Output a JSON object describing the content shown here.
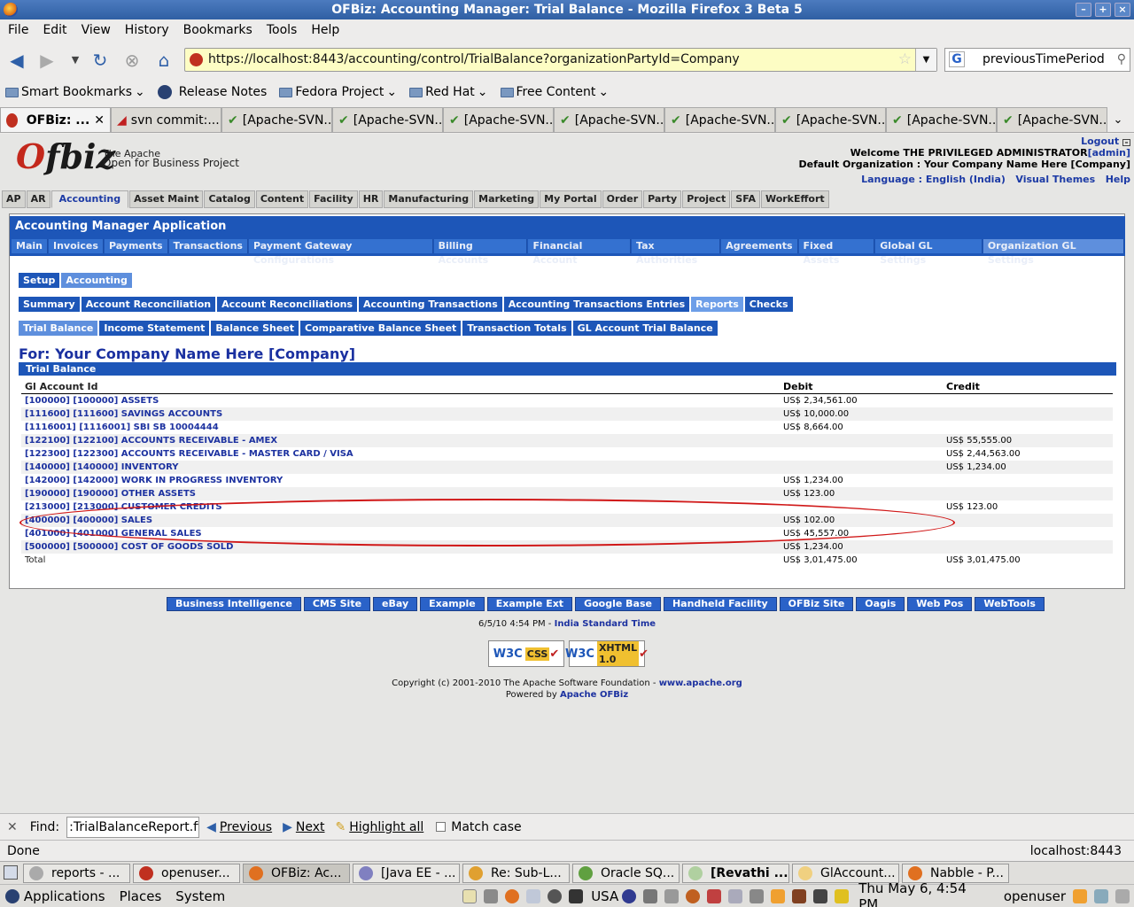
{
  "window": {
    "title": "OFBiz: Accounting Manager: Trial Balance - Mozilla Firefox 3 Beta 5"
  },
  "menu": [
    "File",
    "Edit",
    "View",
    "History",
    "Bookmarks",
    "Tools",
    "Help"
  ],
  "url": "https://localhost:8443/accounting/control/TrialBalance?organizationPartyId=Company",
  "search": {
    "value": "previousTimePeriod"
  },
  "bookmarks": [
    "Smart Bookmarks",
    "Release Notes",
    "Fedora Project",
    "Red Hat",
    "Free Content"
  ],
  "browser_tabs": [
    "OFBiz: ...",
    "svn commit:...",
    "[Apache-SVN...",
    "[Apache-SVN...",
    "[Apache-SVN...",
    "[Apache-SVN...",
    "[Apache-SVN...",
    "[Apache-SVN...",
    "[Apache-SVN...",
    "[Apache-SVN..."
  ],
  "header": {
    "logo_text": "fbiz",
    "logo_tag1": "The Apache",
    "logo_tag2": "Open for Business Project",
    "logout": "Logout",
    "welcome": "Welcome THE PRIVILEGED ADMINISTRATOR",
    "user": "[admin]",
    "org": "Default Organization : Your Company Name Here [Company]",
    "language": "Language : English (India)",
    "themes": "Visual Themes",
    "help": "Help"
  },
  "app_tabs": [
    "AP",
    "AR",
    "Accounting",
    "Asset Maint",
    "Catalog",
    "Content",
    "Facility",
    "HR",
    "Manufacturing",
    "Marketing",
    "My Portal",
    "Order",
    "Party",
    "Project",
    "SFA",
    "WorkEffort"
  ],
  "app_title": "Accounting Manager Application",
  "main_nav": [
    "Main",
    "Invoices",
    "Payments",
    "Transactions",
    "Payment Gateway Configurations",
    "Billing Accounts",
    "Financial Account",
    "Tax Authorities",
    "Agreements",
    "Fixed Assets",
    "Global GL Settings",
    "Organization GL Settings"
  ],
  "setup_nav": [
    "Setup",
    "Accounting"
  ],
  "acct_nav": [
    "Summary",
    "Account Reconciliation",
    "Account Reconciliations",
    "Accounting Transactions",
    "Accounting Transactions Entries",
    "Reports",
    "Checks"
  ],
  "report_nav": [
    "Trial Balance",
    "Income Statement",
    "Balance Sheet",
    "Comparative Balance Sheet",
    "Transaction Totals",
    "GL Account Trial Balance"
  ],
  "for_company": "For: Your Company Name Here [Company]",
  "table_title": "Trial Balance",
  "columns": [
    "Gl Account Id",
    "Debit",
    "Credit"
  ],
  "rows": [
    [
      "[100000] [100000] ASSETS",
      "US$ 2,34,561.00",
      ""
    ],
    [
      "[111600] [111600] SAVINGS ACCOUNTS",
      "US$ 10,000.00",
      ""
    ],
    [
      "[1116001] [1116001] SBI SB 10004444",
      "US$ 8,664.00",
      ""
    ],
    [
      "[122100] [122100] ACCOUNTS RECEIVABLE - AMEX",
      "",
      "US$ 55,555.00"
    ],
    [
      "[122300] [122300] ACCOUNTS RECEIVABLE - MASTER CARD / VISA",
      "",
      "US$ 2,44,563.00"
    ],
    [
      "[140000] [140000] INVENTORY",
      "",
      "US$ 1,234.00"
    ],
    [
      "[142000] [142000] WORK IN PROGRESS INVENTORY",
      "US$ 1,234.00",
      ""
    ],
    [
      "[190000] [190000] OTHER ASSETS",
      "US$ 123.00",
      ""
    ],
    [
      "[213000] [213000] CUSTOMER CREDITS",
      "",
      "US$ 123.00"
    ],
    [
      "[400000] [400000] SALES",
      "US$ 102.00",
      ""
    ],
    [
      "[401000] [401000] GENERAL SALES",
      "US$ 45,557.00",
      ""
    ],
    [
      "[500000] [500000] COST OF GOODS SOLD",
      "US$ 1,234.00",
      ""
    ],
    [
      "Total",
      "US$ 3,01,475.00",
      "US$ 3,01,475.00"
    ]
  ],
  "footer_links": [
    "Business Intelligence",
    "CMS Site",
    "eBay",
    "Example",
    "Example Ext",
    "Google Base",
    "Handheld Facility",
    "OFBiz Site",
    "Oagis",
    "Web Pos",
    "WebTools"
  ],
  "footer": {
    "datetime": "6/5/10 4:54 PM - ",
    "tz": "India Standard Time",
    "css_badge": "W3C",
    "css_label": "CSS",
    "xhtml_badge": "W3C",
    "xhtml_label": "XHTML 1.0",
    "copyright": "Copyright (c) 2001-2010 The Apache Software Foundation - ",
    "apache": "www.apache.org",
    "powered": "Powered by ",
    "ofbiz": "Apache OFBiz"
  },
  "find": {
    "label": "Find:",
    "value": ":TrialBalanceReport.ftl",
    "previous": "Previous",
    "next": "Next",
    "highlight": "Highlight all",
    "match": "Match case"
  },
  "status": {
    "left": "Done",
    "right": "localhost:8443"
  },
  "taskbar": [
    "reports - ...",
    "openuser...",
    "OFBiz: Ac...",
    "[Java EE - ...",
    "Re: Sub-L...",
    "Oracle SQ...",
    "[Revathi ...",
    "GlAccount...",
    "Nabble - P..."
  ],
  "gnome": {
    "applications": "Applications",
    "places": "Places",
    "system": "System",
    "locale": "USA",
    "clock": "Thu May  6,  4:54 PM",
    "user": "openuser"
  }
}
